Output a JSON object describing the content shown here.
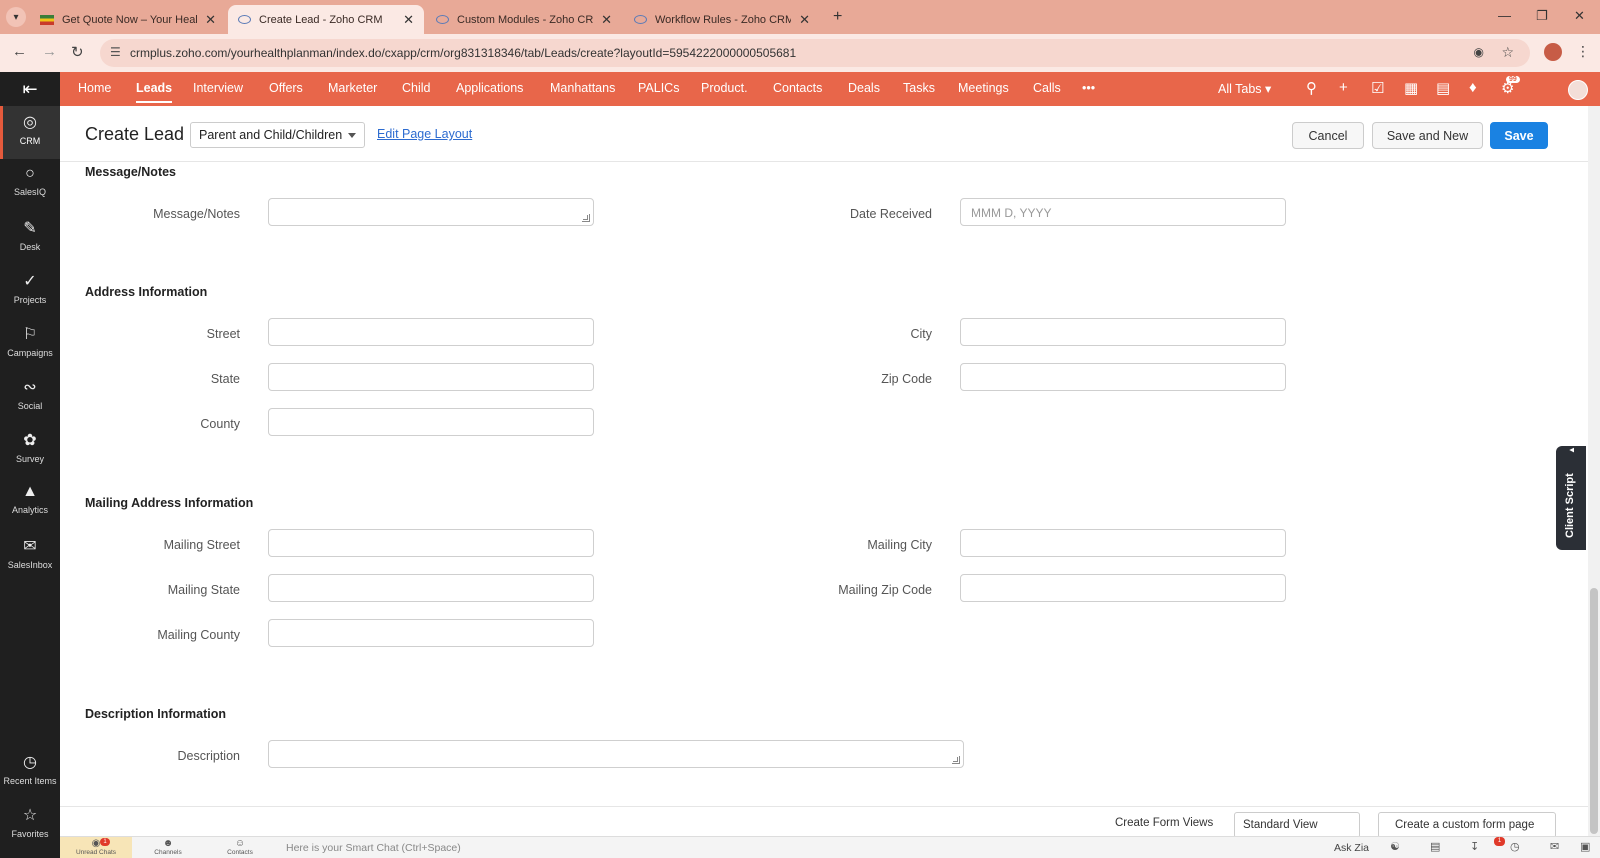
{
  "browser": {
    "tabs": [
      {
        "title": "Get Quote Now – Your Health P",
        "favicon": "quote"
      },
      {
        "title": "Create Lead - Zoho CRM",
        "favicon": "zoho",
        "active": true
      },
      {
        "title": "Custom Modules - Zoho CRM",
        "favicon": "zoho"
      },
      {
        "title": "Workflow Rules - Zoho CRM",
        "favicon": "zoho"
      }
    ],
    "url": "crmplus.zoho.com/yourhealthplanman/index.do/cxapp/crm/org831318346/tab/Leads/create?layoutId=5954222000000505681"
  },
  "sidebar": {
    "items": [
      {
        "label": "CRM",
        "icon": "crm-icon",
        "active": true
      },
      {
        "label": "SalesIQ",
        "icon": "salesiq-icon"
      },
      {
        "label": "Desk",
        "icon": "desk-icon"
      },
      {
        "label": "Projects",
        "icon": "projects-icon"
      },
      {
        "label": "Campaigns",
        "icon": "campaigns-icon"
      },
      {
        "label": "Social",
        "icon": "social-icon"
      },
      {
        "label": "Survey",
        "icon": "survey-icon"
      },
      {
        "label": "Analytics",
        "icon": "analytics-icon"
      },
      {
        "label": "SalesInbox",
        "icon": "salesinbox-icon"
      }
    ],
    "bottom_items": [
      {
        "label": "Recent Items",
        "icon": "recent-items-icon"
      },
      {
        "label": "Favorites",
        "icon": "favorites-icon"
      }
    ]
  },
  "topnav": {
    "items": [
      "Home",
      "Leads",
      "Interview",
      "Offers",
      "Marketer",
      "Child",
      "Applications",
      "Manhattans",
      "PALICs",
      "Product.",
      "Contacts",
      "Deals",
      "Tasks",
      "Meetings",
      "Calls"
    ],
    "active": "Leads",
    "more_label": "•••",
    "all_tabs_label": "All Tabs",
    "notification_count": "99"
  },
  "header": {
    "title": "Create Lead",
    "layout_value": "Parent and Child/Children",
    "edit_layout_label": "Edit Page Layout",
    "cancel_label": "Cancel",
    "save_new_label": "Save and New",
    "save_label": "Save"
  },
  "form": {
    "message_section": "Message/Notes",
    "message_label": "Message/Notes",
    "date_received_label": "Date Received",
    "date_received_placeholder": "MMM D, YYYY",
    "address_section": "Address Information",
    "street_label": "Street",
    "city_label": "City",
    "state_label": "State",
    "zip_label": "Zip Code",
    "county_label": "County",
    "mailing_section": "Mailing Address Information",
    "mailing_street_label": "Mailing Street",
    "mailing_city_label": "Mailing City",
    "mailing_state_label": "Mailing State",
    "mailing_zip_label": "Mailing Zip Code",
    "mailing_county_label": "Mailing County",
    "description_section": "Description Information",
    "description_label": "Description"
  },
  "footer": {
    "create_form_views_label": "Create Form Views",
    "view_value": "Standard View",
    "custom_page_label": "Create a custom form page"
  },
  "chatbar": {
    "tabs": [
      "Unread Chats",
      "Channels",
      "Contacts"
    ],
    "unread_count": "1",
    "smart_chat_placeholder": "Here is your Smart Chat (Ctrl+Space)",
    "ask_zia_label": "Ask Zia",
    "downloads_count": "1"
  },
  "client_script_label": "Client Script",
  "colors": {
    "brand": "#e8664a",
    "primary_button": "#1a82e2",
    "sidebar": "#1f1f1f"
  }
}
